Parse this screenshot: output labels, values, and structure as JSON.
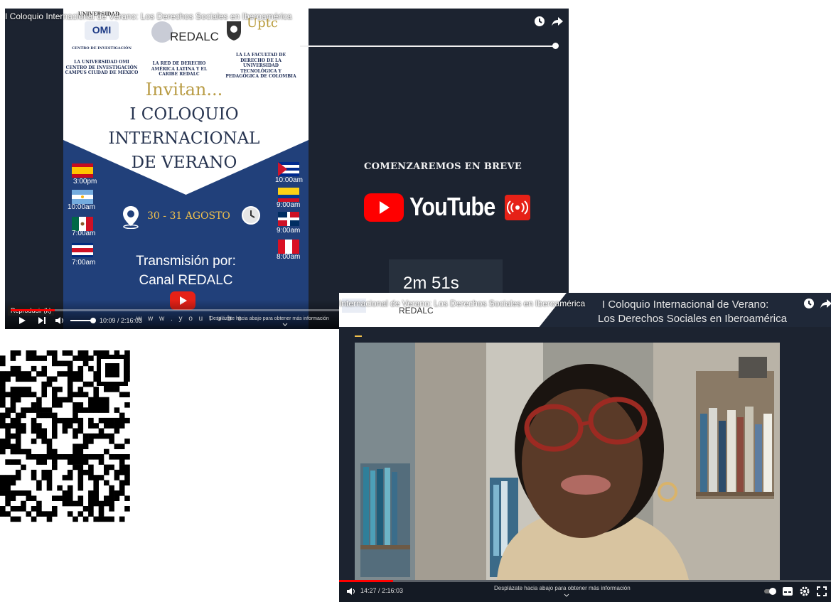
{
  "player_top": {
    "title": "I Coloquio Internacional de Verano: Los Derechos Sociales en Iberoamérica",
    "poster": {
      "org_left_top": "UNIVERSIDAD",
      "org_left_logo": "OMI",
      "org_left_sub": "CENTRO DE INVESTIGACIÓN",
      "org_center_logo": "REDALC",
      "org_right_logo": "Uptc",
      "col1": "LA UNIVERSIDAD OMI CENTRO DE INVESTIGACIÓN CAMPUS CIUDAD DE MÉXICO",
      "col2": "LA RED DE DERECHO AMÉRICA LATINA Y EL CARIBE REDALC",
      "col3": "LA LA FACULTAD DE DERECHO DE LA UNIVERSIDAD TECNOLÓGICA Y PEDAGÓGICA DE COLOMBIA",
      "invitan": "Invitan...",
      "event_line1": "I COLOQUIO",
      "event_line2": "INTERNACIONAL",
      "event_line3": "DE VERANO",
      "left_times": [
        "3:00pm",
        "10:00am",
        "7:00am",
        "7:00am"
      ],
      "right_times": [
        "10:00am",
        "9:00am",
        "9:00am",
        "8:00am"
      ],
      "dates": "30 - 31 AGOSTO",
      "transmision": "Transmisión por:",
      "canal": "Canal REDALC",
      "url": "w w w . y o u t u b e"
    },
    "starting_soon": "COMENZAREMOS EN BREVE",
    "youtube_word": "YouTube",
    "countdown": "2m 51s",
    "tooltip": "Reproducir (k)",
    "time": "10:09 / 2:16:03",
    "scroll_hint": "Desplázate hacia abajo para obtener más información",
    "progress": 0.08
  },
  "player_bottom": {
    "title_small": "Internacional de Verano: Los Derechos Sociales en Iberoamérica",
    "title_line1": "I Coloquio Internacional de Verano:",
    "title_line2": "Los Derechos Sociales en Iberoamérica",
    "header_logo": "REDALC",
    "time": "14:27 / 2:16:03",
    "scroll_hint": "Desplázate hacia abajo para obtener más información",
    "progress": 0.11
  },
  "colors": {
    "youtube_red": "#ff0000",
    "poster_blue": "#21407a",
    "player_bg": "#1c2330"
  }
}
